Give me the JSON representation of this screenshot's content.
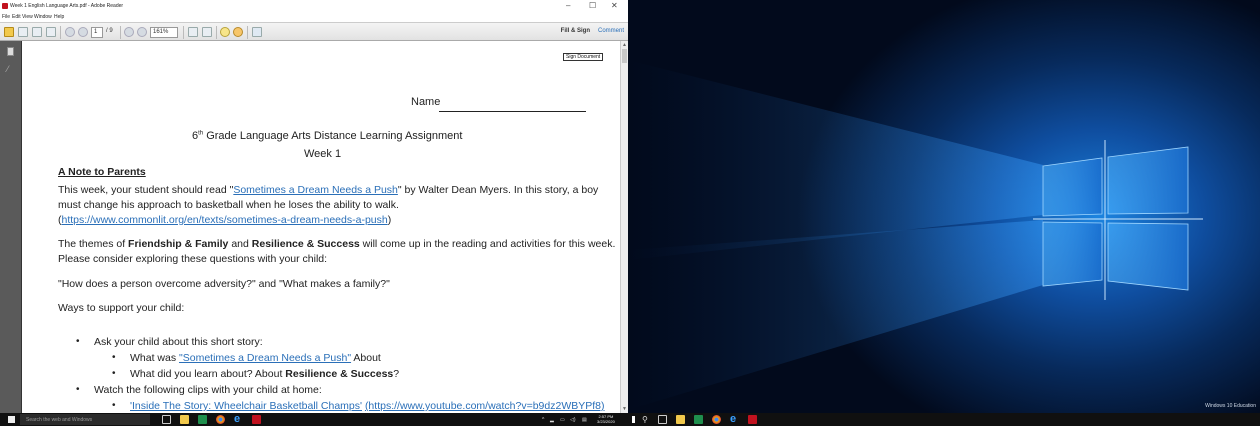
{
  "reader": {
    "window_title": "Week 1 English Language Arts.pdf - Adobe Reader",
    "window_controls": [
      "–",
      "☐",
      "✕"
    ],
    "menu": [
      "File",
      "Edit",
      "View",
      "Window",
      "Help"
    ],
    "page_input": "1",
    "page_total": "/ 9",
    "zoom": "161%",
    "fill_sign": "Fill & Sign",
    "comment": "Comment",
    "sign_document": "Sign Document"
  },
  "document": {
    "name_label": "Name",
    "title_line": "Grade Language Arts Distance Learning Assignment",
    "grade_num": "6",
    "grade_sup": "th",
    "week": "Week 1",
    "note_heading": "A Note to Parents",
    "p1_a": "This week, your student should read \"",
    "p1_link": "Sometimes a Dream Needs a Push",
    "p1_b": "\" by Walter Dean Myers. In this story, a boy",
    "p1_line2": "must change his approach to basketball when he loses the ability to walk.",
    "p1_url": "https://www.commonlit.org/en/texts/sometimes-a-dream-needs-a-push",
    "p1_open": "(",
    "p1_close": ")",
    "p2_a": "The themes of ",
    "p2_theme1": "Friendship & Family",
    "p2_and": " and ",
    "p2_theme2": "Resilience & Success",
    "p2_b": " will come up in the reading and activities for this week.",
    "p2_line2": "Please consider exploring these questions with your child:",
    "questions": "\"How does a person overcome adversity?\" and \"What makes a family?\"",
    "ways": "Ways to support your child:",
    "bullet1": "Ask your child about this short story:",
    "sub1_a": "What was ",
    "sub1_link": "\"Sometimes a Dream Needs a Push\"",
    "sub1_b": " About",
    "sub2_a": "What did you learn about? About ",
    "sub2_b": "Resilience & Success",
    "sub2_c": "?",
    "bullet2": "Watch the following clips with your child at home:",
    "sub3_link": "'Inside The Story: Wheelchair Basketball Champs'",
    "sub3_url": "(https://www.youtube.com/watch?v=b9dz2WBYPf8)"
  },
  "taskbar": {
    "search_placeholder": "Search the web and Windows",
    "clock_time": "2:57 PM",
    "clock_date": "3/23/2020"
  },
  "desktop": {
    "watermark": "Windows 10 Education"
  },
  "colors": {
    "link": "#2a6fb8",
    "taskbar": "#101010",
    "desktop_glow": "#1c84e0"
  },
  "icons": [
    "adobe-reader-icon",
    "open-icon",
    "save-icon",
    "print-icon",
    "email-icon",
    "prev-page-icon",
    "next-page-icon",
    "zoom-out-icon",
    "zoom-in-icon",
    "fit-page-icon",
    "fit-width-icon",
    "comment-icon",
    "highlight-icon",
    "sign-icon",
    "pages-panel-icon",
    "attachments-icon",
    "start-icon",
    "task-view-icon",
    "file-explorer-icon",
    "store-icon",
    "excel-icon",
    "chrome-icon",
    "edge-icon",
    "acrobat-icon"
  ]
}
